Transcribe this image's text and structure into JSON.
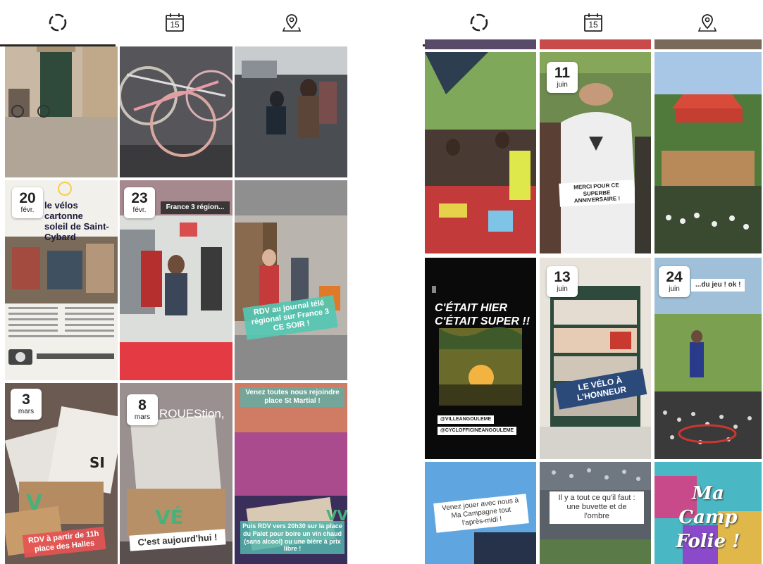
{
  "tabs": [
    {
      "name": "stories-tab",
      "icon": "circle-dashed-icon"
    },
    {
      "name": "calendar-tab",
      "icon": "calendar-icon",
      "label": "15"
    },
    {
      "name": "location-tab",
      "icon": "location-pin-icon"
    }
  ],
  "left": {
    "tiles": {
      "t4": {
        "day": "20",
        "month": "févr.",
        "headline1": "le vélos cartonne",
        "headline2": "soleil de Saint-Cybard"
      },
      "t5": {
        "day": "23",
        "month": "févr.",
        "caption": "France 3 région..."
      },
      "t6": {
        "caption": "RDV au journal télé régional sur France 3 CE SOIR !"
      },
      "t7": {
        "day": "3",
        "month": "mars",
        "caption": "RDV à partir de 11h place des Halles"
      },
      "t8": {
        "day": "8",
        "month": "mars",
        "title": "ROUEStion,",
        "caption": "C'est aujourd'hui !"
      },
      "t9": {
        "caption1": "Venez toutes nous rejoindre place St Martial !",
        "caption2": "Puis RDV vers 20h30 sur la place du Palet pour boire un vin chaud (sans alcool) ou une bière à prix libre !"
      }
    }
  },
  "right": {
    "tiles": {
      "r2": {
        "day": "11",
        "month": "juin",
        "caption": "MERCI POUR CE SUPERBE ANNIVERSAIRE !"
      },
      "r4": {
        "line1": "C'ÉTAIT HIER",
        "line2": "C'ÉTAIT SUPER !!",
        "tag1": "@VILLEANGOULEME",
        "tag2": "@CYCLOFFICINEANGOULEME"
      },
      "r5": {
        "day": "13",
        "month": "juin",
        "banner": "LE VÉLO À L'HONNEUR"
      },
      "r6": {
        "day": "24",
        "month": "juin",
        "caption": "...du jeu ! ok !"
      },
      "r7": {
        "caption": "Venez jouer avec nous à Ma Campagne tout l'après-midi !"
      },
      "r8": {
        "caption": "Il y a tout ce qu'il faut : une buvette et de l'ombre"
      },
      "r9": {
        "caption": "Ma Camp Folie !"
      }
    }
  },
  "colors": {
    "underline": "#262626",
    "teal": "#54c8b2",
    "red": "#e85252",
    "navy": "#2b4a7a"
  }
}
